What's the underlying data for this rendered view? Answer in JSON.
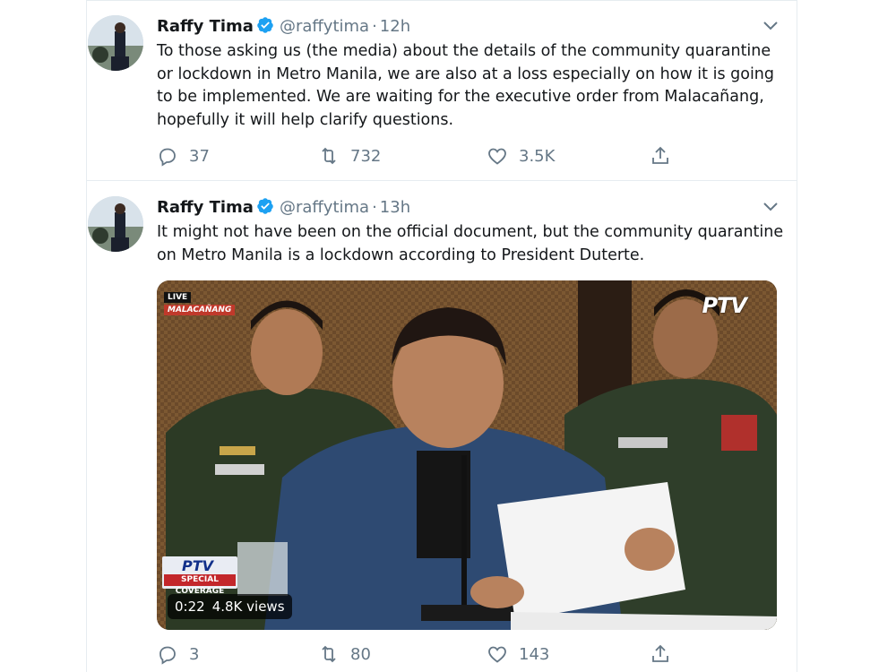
{
  "tweets": [
    {
      "name": "Raffy Tima",
      "handle": "@raffytima",
      "dot": "·",
      "time": "12h",
      "text": "To those asking us (the media) about the details of the community quarantine or lockdown in Metro Manila, we are also at a loss especially on how it is going to be implemented. We are waiting for the executive order from Malacañang, hopefully it will help clarify questions.",
      "replies": "37",
      "retweets": "732",
      "likes": "3.5K"
    },
    {
      "name": "Raffy Tima",
      "handle": "@raffytima",
      "dot": "·",
      "time": "13h",
      "text": "It might not have been on the official document, but the community quarantine on Metro Manila is a lockdown according to President Duterte.",
      "replies": "3",
      "retweets": "80",
      "likes": "143",
      "video": {
        "live_label": "LIVE",
        "location_label": "MALACAÑANG",
        "channel_logo": "PTV",
        "overlay_logo": "PTV",
        "overlay_caption": "SPECIAL COVERAGE",
        "duration": "0:22",
        "views": "4.8K views"
      }
    }
  ],
  "icons": {
    "verified": "verified-badge-icon",
    "reply": "reply-icon",
    "retweet": "retweet-icon",
    "like": "heart-icon",
    "share": "share-icon",
    "menu": "chevron-down-icon"
  },
  "colors": {
    "accent": "#1da1f2",
    "muted": "#657786",
    "border": "#e6ecf0"
  }
}
